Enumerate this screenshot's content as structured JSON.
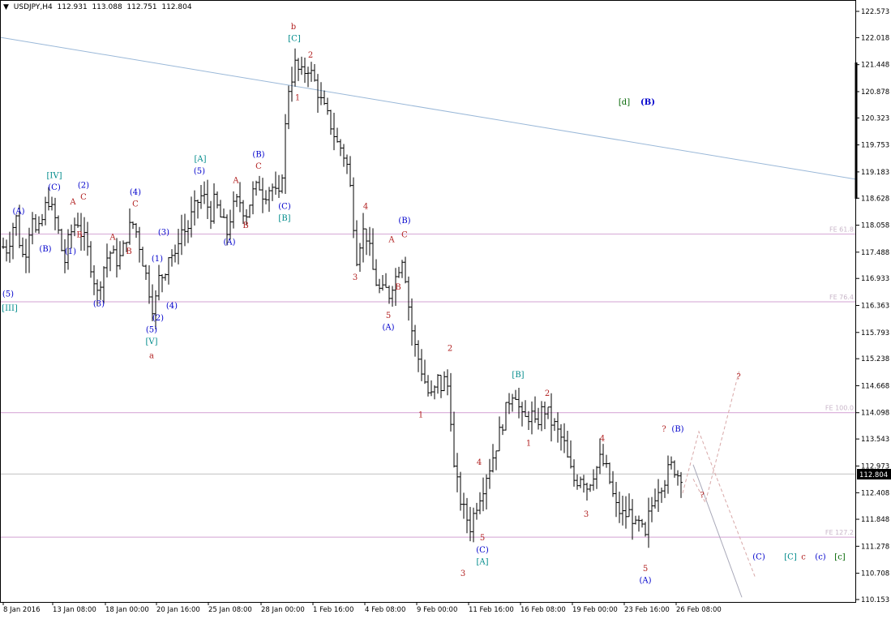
{
  "header": {
    "symbol": "USDJPY,H4",
    "open": "112.931",
    "high": "113.088",
    "low": "112.751",
    "close": "112.804"
  },
  "price_box": "112.804",
  "colors": {
    "bar": "#000000",
    "red": "#b22222",
    "blue": "#0000cc",
    "teal": "#008b8b",
    "green": "#006400",
    "fib": "#dcb4dc",
    "trend": "#9ab8d8"
  },
  "chart_data": {
    "type": "line",
    "title": "USDJPY,H4",
    "ylim": [
      110.153,
      122.573
    ],
    "y_ticks": [
      "122.573",
      "122.018",
      "121.448",
      "120.878",
      "120.323",
      "119.753",
      "119.183",
      "118.628",
      "118.058",
      "117.488",
      "116.933",
      "116.363",
      "115.793",
      "115.238",
      "114.668",
      "114.098",
      "113.543",
      "112.973",
      "112.408",
      "111.848",
      "111.278",
      "110.708",
      "110.153"
    ],
    "x_tick_labels": [
      "8 Jan 2016",
      "13 Jan 08:00",
      "18 Jan 00:00",
      "20 Jan 16:00",
      "25 Jan 08:00",
      "28 Jan 00:00",
      "1 Feb 16:00",
      "4 Feb 08:00",
      "9 Feb 00:00",
      "11 Feb 16:00",
      "16 Feb 08:00",
      "19 Feb 00:00",
      "23 Feb 16:00",
      "26 Feb 08:00"
    ],
    "fib_levels": [
      {
        "label": "FE 61.8",
        "value": 117.87
      },
      {
        "label": "FE 76.4",
        "value": 116.44
      },
      {
        "label": "FE 100.0",
        "value": 114.1
      },
      {
        "label": "FE 127.2",
        "value": 111.47
      }
    ],
    "current_price": 112.804,
    "close_path": [
      [
        0,
        118.0
      ],
      [
        5,
        117.5
      ],
      [
        10,
        117.6
      ],
      [
        15,
        118.0
      ],
      [
        20,
        118.2
      ],
      [
        25,
        117.6
      ],
      [
        30,
        117.3
      ],
      [
        35,
        117.9
      ],
      [
        40,
        118.3
      ],
      [
        45,
        117.8
      ],
      [
        50,
        118.0
      ],
      [
        55,
        118.4
      ],
      [
        60,
        118.6
      ],
      [
        65,
        118.3
      ],
      [
        70,
        118.1
      ],
      [
        75,
        117.6
      ],
      [
        80,
        117.3
      ],
      [
        85,
        117.8
      ],
      [
        90,
        118.0
      ],
      [
        95,
        118.2
      ],
      [
        100,
        117.9
      ],
      [
        105,
        117.7
      ],
      [
        110,
        117.4
      ],
      [
        115,
        117.0
      ],
      [
        120,
        116.6
      ],
      [
        125,
        117.0
      ],
      [
        130,
        117.3
      ],
      [
        135,
        117.5
      ],
      [
        140,
        117.4
      ],
      [
        145,
        117.3
      ],
      [
        150,
        117.4
      ],
      [
        155,
        117.8
      ],
      [
        160,
        118.0
      ],
      [
        165,
        118.1
      ],
      [
        170,
        117.8
      ],
      [
        175,
        117.4
      ],
      [
        180,
        117.0
      ],
      [
        185,
        116.6
      ],
      [
        190,
        116.2
      ],
      [
        195,
        116.9
      ],
      [
        200,
        117.0
      ],
      [
        205,
        117.2
      ],
      [
        210,
        117.6
      ],
      [
        215,
        117.2
      ],
      [
        220,
        117.8
      ],
      [
        225,
        118.0
      ],
      [
        230,
        117.9
      ],
      [
        235,
        118.2
      ],
      [
        240,
        118.4
      ],
      [
        245,
        118.6
      ],
      [
        250,
        118.7
      ],
      [
        255,
        118.5
      ],
      [
        260,
        118.3
      ],
      [
        265,
        118.6
      ],
      [
        270,
        118.3
      ],
      [
        275,
        118.1
      ],
      [
        280,
        117.9
      ],
      [
        285,
        118.3
      ],
      [
        290,
        118.5
      ],
      [
        295,
        118.6
      ],
      [
        300,
        118.4
      ],
      [
        305,
        118.3
      ],
      [
        310,
        118.7
      ],
      [
        315,
        118.8
      ],
      [
        320,
        118.9
      ],
      [
        325,
        118.7
      ],
      [
        330,
        118.8
      ],
      [
        335,
        118.9
      ],
      [
        340,
        118.7
      ],
      [
        345,
        118.6
      ],
      [
        350,
        119.6
      ],
      [
        355,
        120.9
      ],
      [
        360,
        121.2
      ],
      [
        365,
        121.5
      ],
      [
        370,
        121.2
      ],
      [
        375,
        121.3
      ],
      [
        380,
        121.4
      ],
      [
        385,
        121.2
      ],
      [
        390,
        121.0
      ],
      [
        395,
        120.7
      ],
      [
        400,
        120.5
      ],
      [
        405,
        120.3
      ],
      [
        410,
        120.1
      ],
      [
        415,
        119.8
      ],
      [
        420,
        119.7
      ],
      [
        425,
        119.5
      ],
      [
        430,
        119.2
      ],
      [
        435,
        118.3
      ],
      [
        440,
        117.4
      ],
      [
        445,
        117.8
      ],
      [
        450,
        118.0
      ],
      [
        455,
        117.6
      ],
      [
        460,
        117.1
      ],
      [
        465,
        116.8
      ],
      [
        470,
        116.6
      ],
      [
        475,
        116.7
      ],
      [
        480,
        116.6
      ],
      [
        485,
        116.9
      ],
      [
        490,
        117.0
      ],
      [
        495,
        117.5
      ],
      [
        500,
        117.0
      ],
      [
        505,
        116.2
      ],
      [
        510,
        115.6
      ],
      [
        515,
        115.3
      ],
      [
        520,
        115.0
      ],
      [
        525,
        114.7
      ],
      [
        530,
        114.4
      ],
      [
        535,
        114.5
      ],
      [
        540,
        114.8
      ],
      [
        545,
        114.6
      ],
      [
        550,
        114.9
      ],
      [
        555,
        114.3
      ],
      [
        560,
        112.9
      ],
      [
        565,
        112.5
      ],
      [
        570,
        112.1
      ],
      [
        575,
        111.9
      ],
      [
        580,
        111.7
      ],
      [
        585,
        112.0
      ],
      [
        590,
        112.3
      ],
      [
        595,
        112.5
      ],
      [
        600,
        112.8
      ],
      [
        605,
        113.0
      ],
      [
        610,
        113.3
      ],
      [
        615,
        113.6
      ],
      [
        620,
        113.9
      ],
      [
        625,
        114.2
      ],
      [
        630,
        114.5
      ],
      [
        635,
        114.6
      ],
      [
        640,
        114.2
      ],
      [
        645,
        113.9
      ],
      [
        650,
        114.0
      ],
      [
        655,
        114.1
      ],
      [
        660,
        113.8
      ],
      [
        665,
        114.0
      ],
      [
        670,
        114.2
      ],
      [
        675,
        114.1
      ],
      [
        680,
        113.9
      ],
      [
        685,
        113.8
      ],
      [
        690,
        113.6
      ],
      [
        695,
        113.5
      ],
      [
        700,
        113.1
      ],
      [
        705,
        112.8
      ],
      [
        710,
        112.6
      ],
      [
        715,
        112.8
      ],
      [
        720,
        112.7
      ],
      [
        725,
        112.5
      ],
      [
        730,
        112.8
      ],
      [
        735,
        112.9
      ],
      [
        740,
        113.1
      ],
      [
        745,
        113.0
      ],
      [
        750,
        112.8
      ],
      [
        755,
        112.4
      ],
      [
        760,
        112.1
      ],
      [
        765,
        112.0
      ],
      [
        770,
        111.9
      ],
      [
        775,
        112.0
      ],
      [
        780,
        111.9
      ],
      [
        785,
        111.6
      ],
      [
        790,
        111.8
      ],
      [
        795,
        111.3
      ],
      [
        800,
        111.9
      ],
      [
        805,
        112.2
      ],
      [
        810,
        112.5
      ],
      [
        815,
        112.6
      ],
      [
        820,
        112.7
      ],
      [
        825,
        112.9
      ],
      [
        830,
        113.0
      ],
      [
        835,
        112.8
      ],
      [
        840,
        112.8
      ]
    ],
    "projections": [
      {
        "name": "solid",
        "points": [
          [
            855,
            113.0
          ],
          [
            915,
            110.2
          ]
        ]
      },
      {
        "name": "dashed-1",
        "points": [
          [
            842,
            112.4
          ],
          [
            862,
            113.7
          ],
          [
            932,
            110.6
          ]
        ]
      },
      {
        "name": "dashed-2",
        "points": [
          [
            855,
            112.7
          ],
          [
            870,
            112.2
          ],
          [
            912,
            115.0
          ]
        ]
      }
    ],
    "wave_labels": [
      {
        "t": "b",
        "x": 362,
        "y": 122.2,
        "c": "red",
        "s": 14
      },
      {
        "t": "[C]",
        "x": 363,
        "y": 121.95,
        "c": "teal"
      },
      {
        "t": "2",
        "x": 383,
        "y": 121.6,
        "c": "red"
      },
      {
        "t": "1",
        "x": 367,
        "y": 120.7,
        "c": "red"
      },
      {
        "t": "[d]",
        "x": 770,
        "y": 120.6,
        "c": "green",
        "s": 15
      },
      {
        "t": "(B)",
        "x": 799,
        "y": 120.6,
        "c": "blue",
        "s": 15,
        "b": true
      },
      {
        "t": "(C)",
        "x": 351,
        "y": 118.4,
        "c": "blue"
      },
      {
        "t": "[B]",
        "x": 351,
        "y": 118.15,
        "c": "teal"
      },
      {
        "t": "4",
        "x": 451,
        "y": 118.4,
        "c": "red"
      },
      {
        "t": "(B)",
        "x": 499,
        "y": 118.1,
        "c": "blue"
      },
      {
        "t": "C",
        "x": 499,
        "y": 117.8,
        "c": "red"
      },
      {
        "t": "A",
        "x": 483,
        "y": 117.7,
        "c": "red"
      },
      {
        "t": "B",
        "x": 491,
        "y": 116.7,
        "c": "red"
      },
      {
        "t": "3",
        "x": 438,
        "y": 116.9,
        "c": "red"
      },
      {
        "t": "5",
        "x": 479,
        "y": 116.1,
        "c": "red"
      },
      {
        "t": "(A)",
        "x": 479,
        "y": 115.85,
        "c": "blue"
      },
      {
        "t": "[IV]",
        "x": 67,
        "y": 119.05,
        "c": "teal"
      },
      {
        "t": "(C)",
        "x": 67,
        "y": 118.8,
        "c": "blue"
      },
      {
        "t": "(2)",
        "x": 103,
        "y": 118.85,
        "c": "blue"
      },
      {
        "t": "C",
        "x": 103,
        "y": 118.6,
        "c": "red"
      },
      {
        "t": "A",
        "x": 90,
        "y": 118.5,
        "c": "red"
      },
      {
        "t": "(A)",
        "x": 23,
        "y": 118.3,
        "c": "blue"
      },
      {
        "t": "B",
        "x": 98,
        "y": 117.8,
        "c": "red"
      },
      {
        "t": "(B)",
        "x": 56,
        "y": 117.5,
        "c": "blue"
      },
      {
        "t": "(1)",
        "x": 87,
        "y": 117.45,
        "c": "blue"
      },
      {
        "t": "A",
        "x": 139,
        "y": 117.75,
        "c": "red"
      },
      {
        "t": "B",
        "x": 159,
        "y": 117.45,
        "c": "red"
      },
      {
        "t": "(4)",
        "x": 167,
        "y": 118.7,
        "c": "blue"
      },
      {
        "t": "C",
        "x": 167,
        "y": 118.45,
        "c": "red"
      },
      {
        "t": "(3)",
        "x": 202,
        "y": 117.85,
        "c": "blue"
      },
      {
        "t": "(1)",
        "x": 194,
        "y": 117.3,
        "c": "blue"
      },
      {
        "t": "(3)",
        "x": 122,
        "y": 116.35,
        "c": "blue"
      },
      {
        "t": "(4)",
        "x": 212,
        "y": 116.3,
        "c": "blue"
      },
      {
        "t": "(2)",
        "x": 195,
        "y": 116.05,
        "c": "blue"
      },
      {
        "t": "(5)",
        "x": 187,
        "y": 115.8,
        "c": "blue"
      },
      {
        "t": "[V]",
        "x": 187,
        "y": 115.55,
        "c": "teal"
      },
      {
        "t": "a",
        "x": 187,
        "y": 115.25,
        "c": "red",
        "s": 14
      },
      {
        "t": "(5)",
        "x": 10,
        "y": 116.55,
        "c": "blue"
      },
      {
        "t": "[III]",
        "x": 12,
        "y": 116.25,
        "c": "teal"
      },
      {
        "t": "[A]",
        "x": 247,
        "y": 119.4,
        "c": "teal"
      },
      {
        "t": "(5)",
        "x": 246,
        "y": 119.15,
        "c": "blue"
      },
      {
        "t": "(B)",
        "x": 319,
        "y": 119.5,
        "c": "blue"
      },
      {
        "t": "C",
        "x": 319,
        "y": 119.25,
        "c": "red"
      },
      {
        "t": "A",
        "x": 291,
        "y": 118.95,
        "c": "red"
      },
      {
        "t": "B",
        "x": 303,
        "y": 118.0,
        "c": "red"
      },
      {
        "t": "(A)",
        "x": 283,
        "y": 117.65,
        "c": "blue"
      },
      {
        "t": "2",
        "x": 555,
        "y": 115.4,
        "c": "red"
      },
      {
        "t": "1",
        "x": 519,
        "y": 114.0,
        "c": "red"
      },
      {
        "t": "[B]",
        "x": 639,
        "y": 114.85,
        "c": "teal"
      },
      {
        "t": "2",
        "x": 675,
        "y": 114.45,
        "c": "red"
      },
      {
        "t": "1",
        "x": 652,
        "y": 113.4,
        "c": "red"
      },
      {
        "t": "4",
        "x": 591,
        "y": 113.0,
        "c": "red"
      },
      {
        "t": "4",
        "x": 743,
        "y": 113.5,
        "c": "red"
      },
      {
        "t": "3",
        "x": 723,
        "y": 111.9,
        "c": "red"
      },
      {
        "t": "5",
        "x": 595,
        "y": 111.4,
        "c": "red"
      },
      {
        "t": "(C)",
        "x": 595,
        "y": 111.15,
        "c": "blue"
      },
      {
        "t": "[A]",
        "x": 595,
        "y": 110.9,
        "c": "teal"
      },
      {
        "t": "3",
        "x": 571,
        "y": 110.65,
        "c": "red"
      },
      {
        "t": "5",
        "x": 796,
        "y": 110.75,
        "c": "red"
      },
      {
        "t": "(A)",
        "x": 796,
        "y": 110.5,
        "c": "blue"
      },
      {
        "t": "?",
        "x": 819,
        "y": 113.7,
        "c": "red"
      },
      {
        "t": "(B)",
        "x": 836,
        "y": 113.7,
        "c": "blue"
      },
      {
        "t": "?",
        "x": 911,
        "y": 114.8,
        "c": "red"
      },
      {
        "t": "?",
        "x": 866,
        "y": 112.3,
        "c": "red"
      },
      {
        "t": "(C)",
        "x": 936,
        "y": 111.0,
        "c": "blue"
      },
      {
        "t": "[C]",
        "x": 975,
        "y": 111.0,
        "c": "teal"
      },
      {
        "t": "c",
        "x": 991,
        "y": 111.0,
        "c": "red",
        "s": 15
      },
      {
        "t": "(c)",
        "x": 1012,
        "y": 111.0,
        "c": "blue",
        "s": 15
      },
      {
        "t": "[c]",
        "x": 1036,
        "y": 111.0,
        "c": "green",
        "s": 15
      }
    ]
  }
}
